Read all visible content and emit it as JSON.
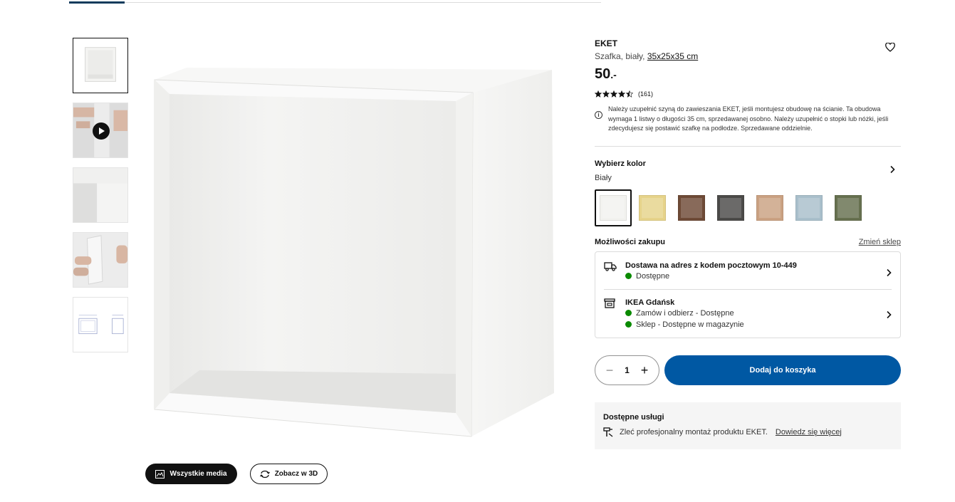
{
  "product": {
    "name": "EKET",
    "description": "Szafka, biały,",
    "dimensions": "35x25x35 cm",
    "price": "50",
    "price_suffix": ".-",
    "rating": 4.5,
    "rating_count": "(161)",
    "info": "Należy uzupełnić szyną do zawieszania EKET, jeśli montujesz obudowę na ścianie. Ta obudowa wymaga 1 listwy o długości 35 cm, sprzedawanej osobno. Należy uzupełnić o stopki lub nóżki, jeśli zdecydujesz się postawić szafkę na podłodze. Sprzedawane oddzielnie."
  },
  "color": {
    "title": "Wybierz kolor",
    "selected": "Biały",
    "swatches": [
      "#f2f2ef",
      "#e6d38a",
      "#6e4a36",
      "#4b4a48",
      "#caa182",
      "#a9bfcb",
      "#66704f"
    ]
  },
  "purchase": {
    "title": "Możliwości zakupu",
    "change_store": "Zmień sklep",
    "delivery_title": "Dostawa na adres z kodem pocztowym 10-449",
    "delivery_status": "Dostępne",
    "store_title": "IKEA Gdańsk",
    "store_status_1": "Zamów i odbierz - Dostępne",
    "store_status_2": "Sklep - Dostępne w magazynie"
  },
  "cart": {
    "quantity": "1",
    "add_label": "Dodaj do koszyka"
  },
  "services": {
    "title": "Dostępne usługi",
    "text": "Zleć profesjonalny montaż produktu EKET.",
    "link": "Dowiedz się więcej"
  },
  "media": {
    "all_media": "Wszystkie media",
    "view_3d": "Zobacz w 3D"
  }
}
